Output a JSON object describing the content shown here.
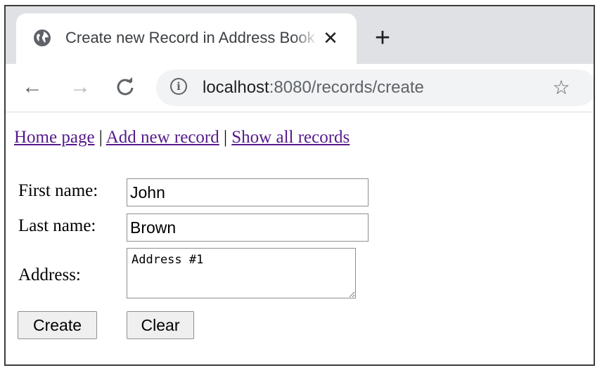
{
  "browser": {
    "tab": {
      "title": "Create new Record in Address Book",
      "globe_icon": "globe-icon",
      "close_icon": "close-icon",
      "close_glyph": "✕"
    },
    "new_tab_glyph": "+",
    "toolbar": {
      "back_glyph": "←",
      "forward_glyph": "→",
      "reload_glyph": "C",
      "info_glyph": "i",
      "url_host": "localhost",
      "url_rest": ":8080/records/create",
      "star_glyph": "☆"
    }
  },
  "page": {
    "nav": {
      "home": "Home page",
      "add": "Add new record",
      "show": "Show all records",
      "separator": "|"
    },
    "form": {
      "first_name_label": "First name:",
      "first_name_value": "John",
      "last_name_label": "Last name:",
      "last_name_value": "Brown",
      "address_label": "Address:",
      "address_value": "Address #1",
      "create_label": "Create",
      "clear_label": "Clear"
    }
  },
  "colors": {
    "tabstrip": "#dfe1e5",
    "omnibox": "#f1f3f4",
    "link_visited": "#551a8b"
  }
}
